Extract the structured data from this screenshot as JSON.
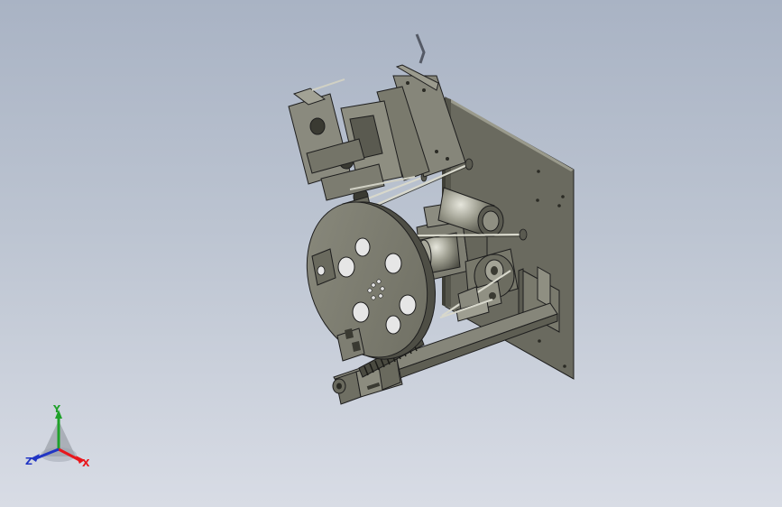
{
  "viewport": {
    "background_top": "#a9b3c4",
    "background_bottom": "#d8dce5"
  },
  "model": {
    "part_color": "#7d7d70",
    "edge_color": "#1e1e1e"
  },
  "triad": {
    "x_label": "X",
    "y_label": "Y",
    "z_label": "Z",
    "x_color": "#e8161c",
    "y_color": "#1fa12a",
    "z_color": "#2135c4"
  }
}
